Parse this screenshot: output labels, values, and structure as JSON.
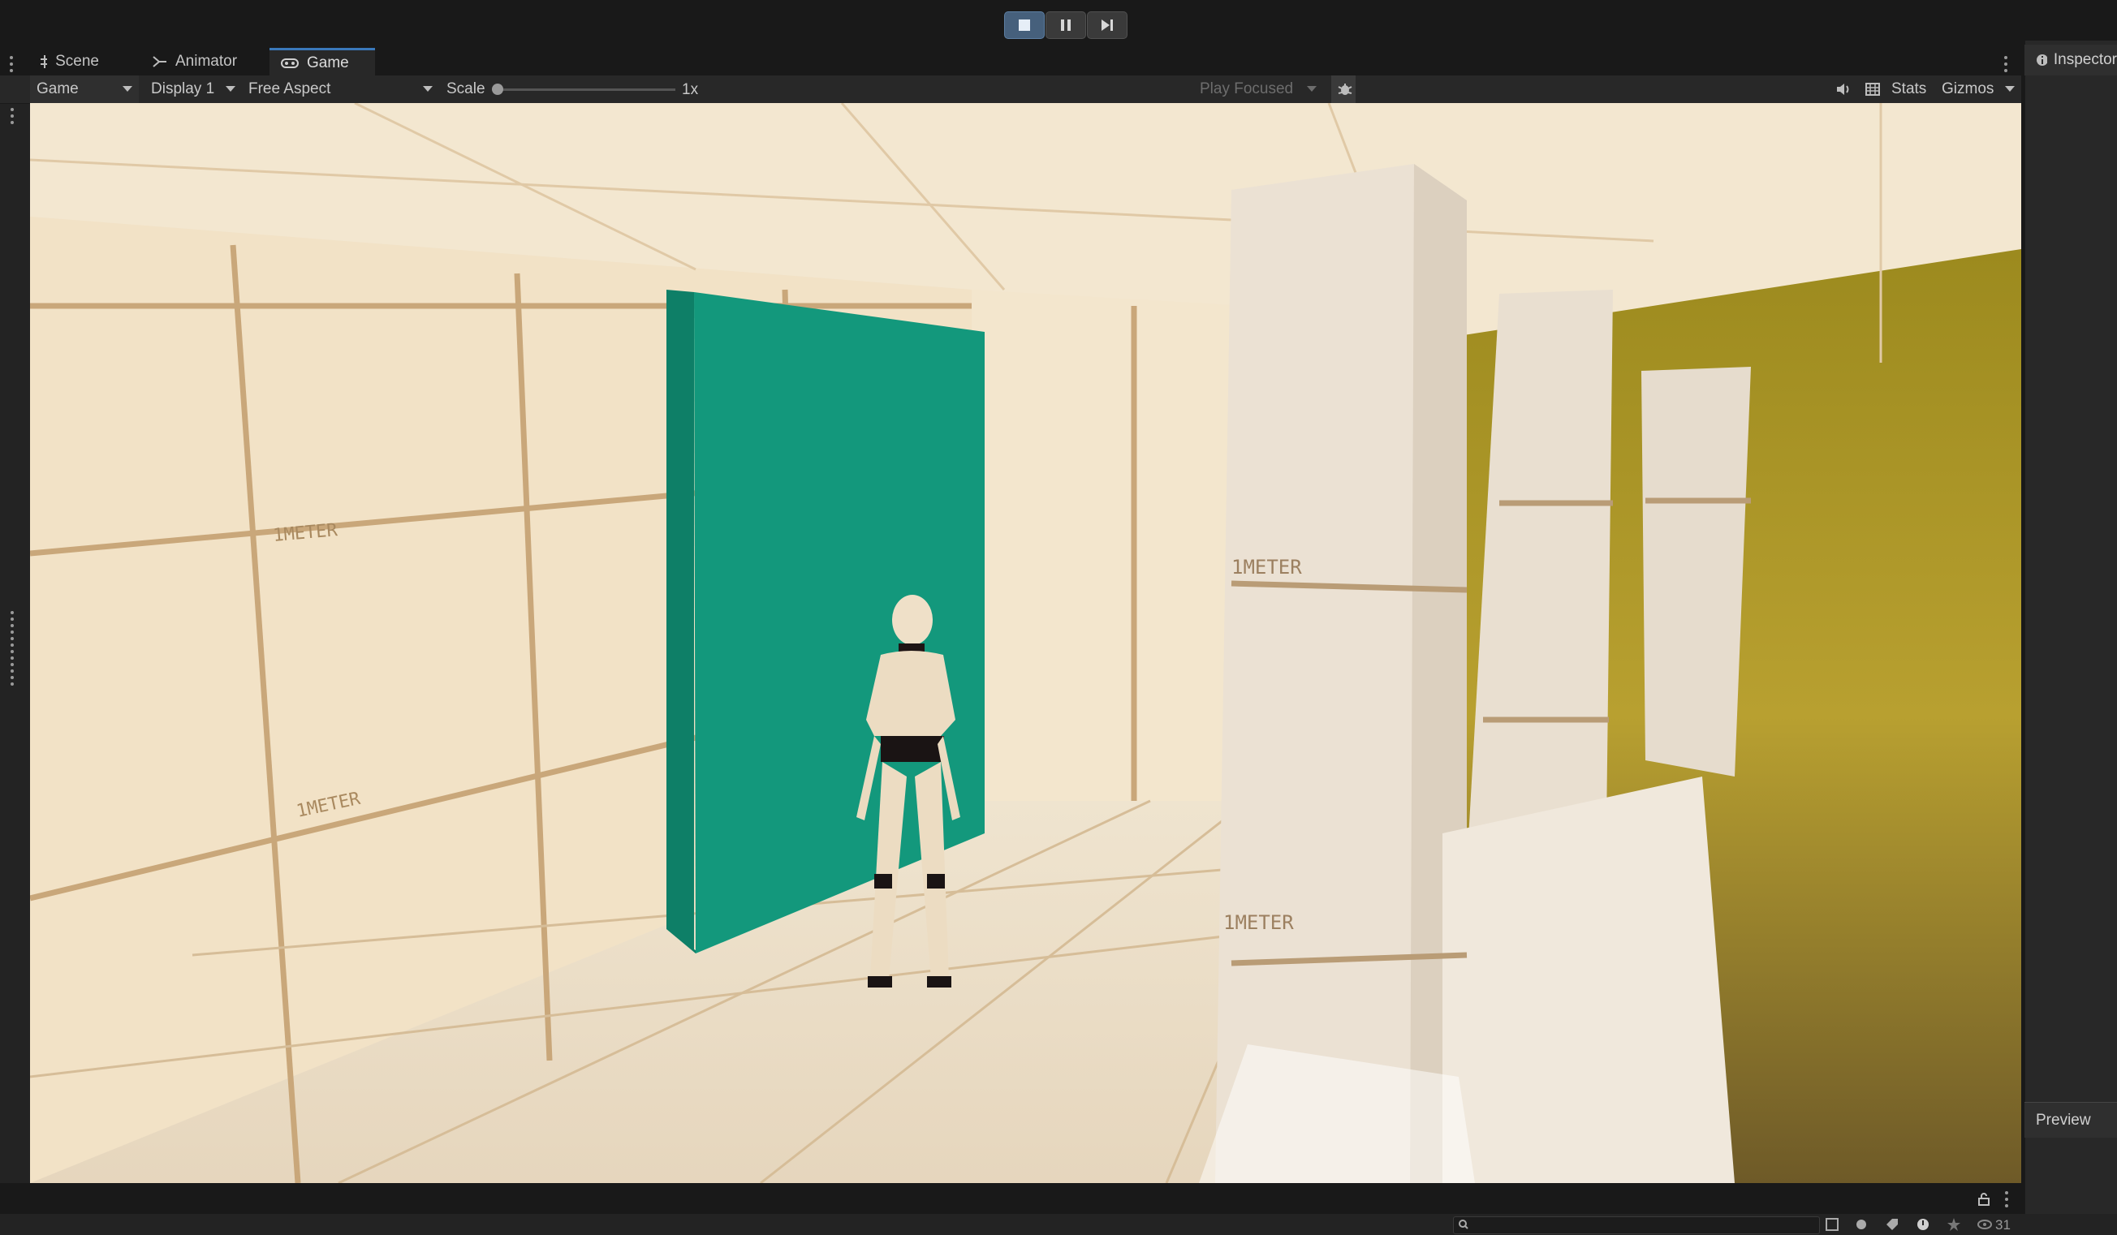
{
  "playbar": {
    "play_state": "playing"
  },
  "tabs": [
    {
      "label": "Scene",
      "icon": "grid-icon"
    },
    {
      "label": "Animator",
      "icon": "animator-icon"
    },
    {
      "label": "Game",
      "icon": "gamepad-icon"
    }
  ],
  "toolbar": {
    "view_dropdown": "Game",
    "display_dropdown": "Display 1",
    "aspect_dropdown": "Free Aspect",
    "scale_label": "Scale",
    "scale_value": "1x",
    "play_mode_dropdown": "Play Focused",
    "stats_label": "Stats",
    "gizmos_label": "Gizmos"
  },
  "viewport": {
    "wall_label": "1METER",
    "colors": {
      "wall": "#f1e2c6",
      "grid": "#c9a77a",
      "panel": "#13987c",
      "grass": "#b09a2a"
    }
  },
  "inspector": {
    "tab_label": "Inspector",
    "preview_label": "Preview"
  },
  "statusbar": {
    "count": "31"
  },
  "accent": "#3a79bb"
}
